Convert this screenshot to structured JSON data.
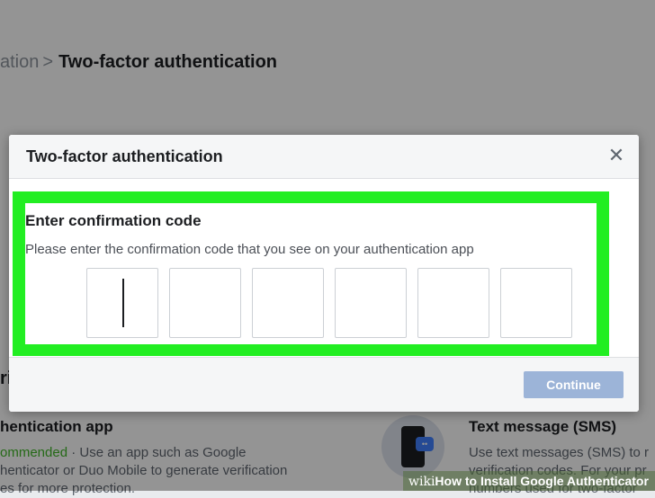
{
  "breadcrumb": {
    "previous": "ation",
    "separator": ">",
    "current": "Two-factor authentication"
  },
  "background": {
    "section_heading": "ri",
    "app_option": {
      "title": "hentication app",
      "recommended": "ommended",
      "description": " · Use an app such as Google\nhenticator or Duo Mobile to generate verification\nes for more protection."
    },
    "sms_option": {
      "title": "Text message (SMS)",
      "description": "Use text messages (SMS) to r\nverification codes. For your pr\nnumbers used for two-factor"
    },
    "icon": "phone-chat-icon"
  },
  "modal": {
    "title": "Two-factor authentication",
    "close_icon": "close-icon",
    "heading": "Enter confirmation code",
    "description": "Please enter the confirmation code that you see on your authentication app",
    "code_inputs": [
      "",
      "",
      "",
      "",
      "",
      ""
    ],
    "continue_label": "Continue"
  },
  "watermark": {
    "wiki": "wiki",
    "text": "How to Install Google Authenticator"
  },
  "colors": {
    "highlight": "#22ee22",
    "button_disabled": "#9cb4d8",
    "recommended": "#42b72a"
  }
}
